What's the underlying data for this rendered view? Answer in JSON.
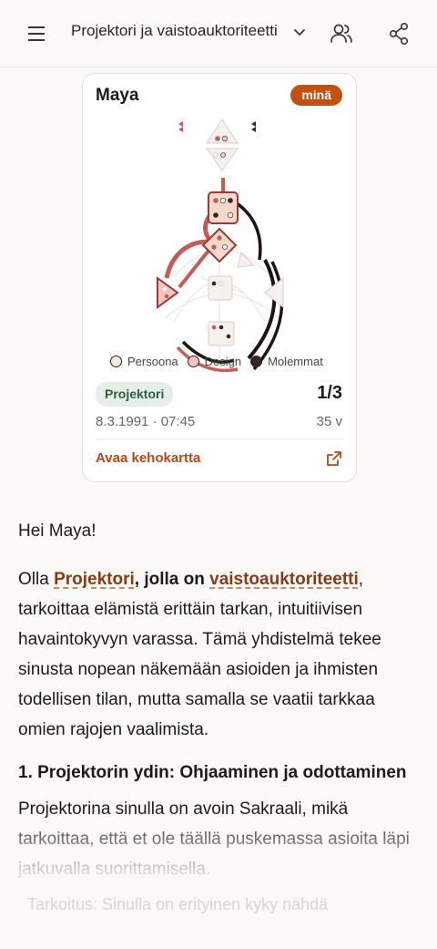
{
  "header": {
    "title": "Projektori ja vaistoauktoriteetti",
    "icons": {
      "menu": "menu-icon",
      "dropdown": "chevron-down-icon",
      "people": "people-icon",
      "share": "share-icon"
    }
  },
  "card": {
    "name": "Maya",
    "badge": "minä",
    "legend": [
      {
        "label": "Persoona",
        "color": "#f8ecd8"
      },
      {
        "label": "Design",
        "color": "#f3c6bd"
      },
      {
        "label": "Molemmat",
        "color": "#3a2420"
      }
    ],
    "type": "Projektori",
    "profile": "1/3",
    "datetime": "8.3.1991 · 07:45",
    "age": "35 v",
    "open_link": "Avaa kehokartta"
  },
  "article": {
    "greeting": "Hei Maya!",
    "p1": {
      "pre": "Olla ",
      "link1": "Projektori",
      "mid": ", jolla on ",
      "link2": "vaistoauktoriteetti",
      "post": ", tarkoittaa elämistä erittäin tarkan, intuitiivisen havaintokyvyn varassa. Tämä yhdistelmä tekee sinusta nopean näkemään asioiden ja ihmisten todellisen tilan, mutta samalla se vaatii tarkkaa omien rajojen vaalimista."
    },
    "h1": "1. Projektorin ydin: Ohjaaminen ja odottaminen",
    "p2": "Projektorina sinulla on avoin Sakraali, mikä tarkoittaa, että et ole täällä puskemassa asioita läpi jatkuvalla suorittamisella.",
    "ghost": "Tarkoitus: Sinulla on erityinen kyky nähdä"
  },
  "colors": {
    "accent": "#c4500f",
    "link": "#8a3a12",
    "chip_bg": "#e6efe7",
    "chip_text": "#2f5d3d",
    "design": "#c85a55",
    "both": "#1e1412"
  }
}
